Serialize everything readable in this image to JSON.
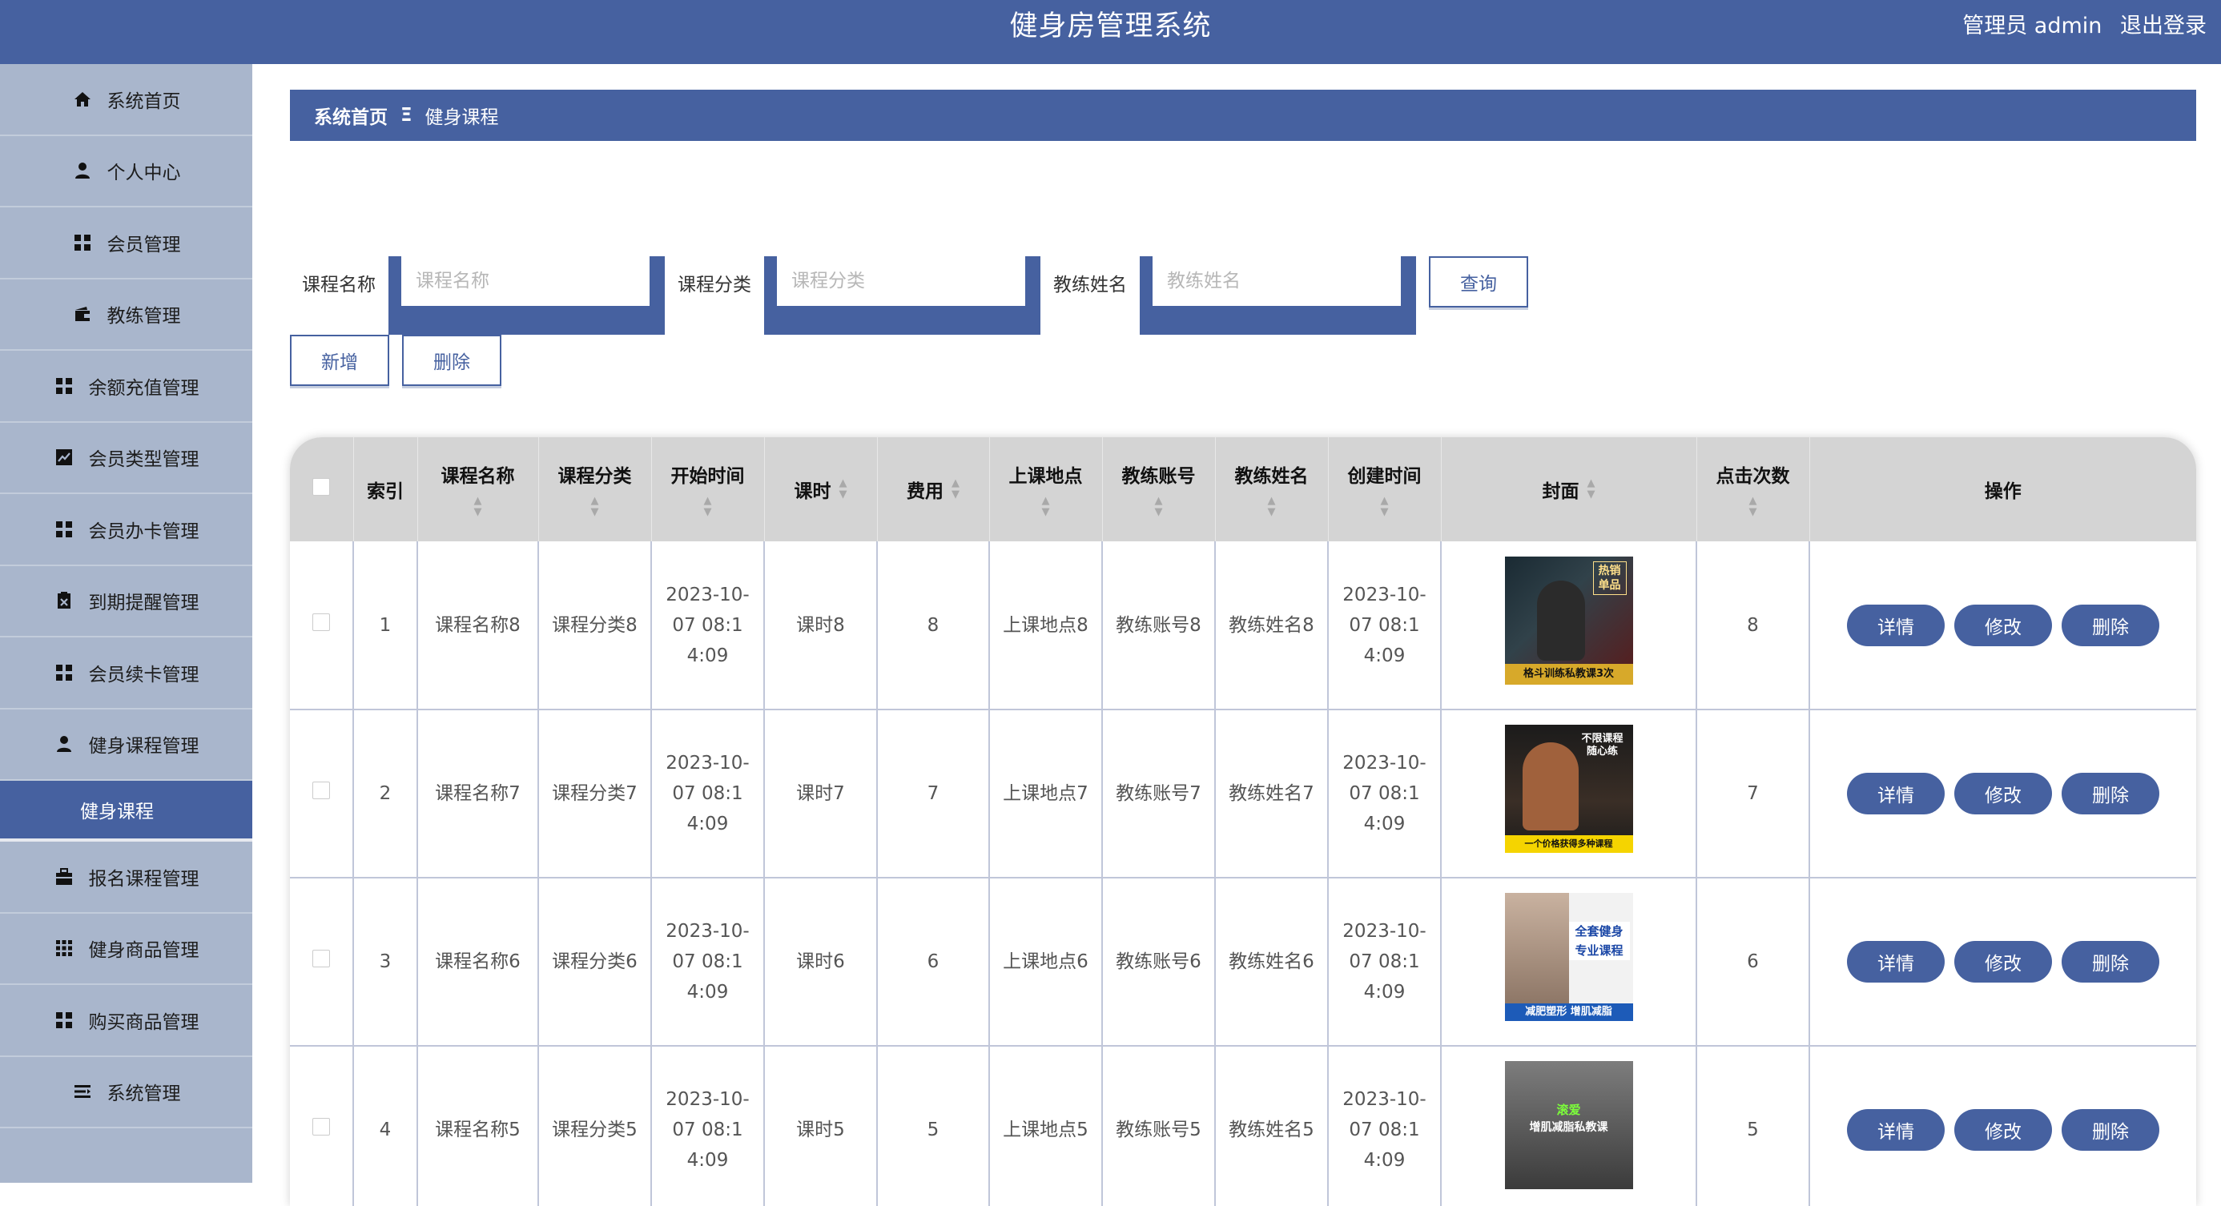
{
  "header": {
    "title": "健身房管理系统",
    "user": "管理员 admin",
    "logout": "退出登录"
  },
  "sidebar": {
    "items": [
      {
        "label": "系统首页",
        "icon": "home-icon"
      },
      {
        "label": "个人中心",
        "icon": "user-icon"
      },
      {
        "label": "会员管理",
        "icon": "grid-icon"
      },
      {
        "label": "教练管理",
        "icon": "wallet-icon"
      },
      {
        "label": "余额充值管理",
        "icon": "grid-icon"
      },
      {
        "label": "会员类型管理",
        "icon": "chart-icon"
      },
      {
        "label": "会员办卡管理",
        "icon": "grid-icon"
      },
      {
        "label": "到期提醒管理",
        "icon": "clipboard-icon"
      },
      {
        "label": "会员续卡管理",
        "icon": "grid-icon"
      },
      {
        "label": "健身课程管理",
        "icon": "user-icon"
      }
    ],
    "active_sub": "健身课程",
    "items_after": [
      {
        "label": "报名课程管理",
        "icon": "briefcase-icon"
      },
      {
        "label": "健身商品管理",
        "icon": "apps-icon"
      },
      {
        "label": "购买商品管理",
        "icon": "grid-icon"
      },
      {
        "label": "系统管理",
        "icon": "list-icon"
      }
    ]
  },
  "breadcrumb": {
    "home": "系统首页",
    "separator": "Ξ",
    "current": "健身课程"
  },
  "search": {
    "fields": [
      {
        "label": "课程名称",
        "placeholder": "课程名称"
      },
      {
        "label": "课程分类",
        "placeholder": "课程分类"
      },
      {
        "label": "教练姓名",
        "placeholder": "教练姓名"
      }
    ],
    "query_button": "查询"
  },
  "actions": {
    "add": "新增",
    "delete": "删除"
  },
  "table": {
    "columns": [
      "索引",
      "课程名称",
      "课程分类",
      "开始时间",
      "课时",
      "费用",
      "上课地点",
      "教练账号",
      "教练姓名",
      "创建时间",
      "封面",
      "点击次数",
      "操作"
    ],
    "rows": [
      {
        "index": "1",
        "name": "课程名称8",
        "category": "课程分类8",
        "start": "2023-10-07 08:14:09",
        "hours": "课时8",
        "fee": "8",
        "place": "上课地点8",
        "coach_account": "教练账号8",
        "coach_name": "教练姓名8",
        "created": "2023-10-07 08:14:09",
        "cover_text": "热销单品",
        "cover_caption": "格斗训练私教课3次",
        "clicks": "8"
      },
      {
        "index": "2",
        "name": "课程名称7",
        "category": "课程分类7",
        "start": "2023-10-07 08:14:09",
        "hours": "课时7",
        "fee": "7",
        "place": "上课地点7",
        "coach_account": "教练账号7",
        "coach_name": "教练姓名7",
        "created": "2023-10-07 08:14:09",
        "cover_text": "不限课程 随心练",
        "cover_caption": "一个价格获得多种课程",
        "clicks": "7"
      },
      {
        "index": "3",
        "name": "课程名称6",
        "category": "课程分类6",
        "start": "2023-10-07 08:14:09",
        "hours": "课时6",
        "fee": "6",
        "place": "上课地点6",
        "coach_account": "教练账号6",
        "coach_name": "教练姓名6",
        "created": "2023-10-07 08:14:09",
        "cover_text": "全套健身 专业课程",
        "cover_caption": "减肥塑形 增肌减脂",
        "clicks": "6"
      },
      {
        "index": "4",
        "name": "课程名称5",
        "category": "课程分类5",
        "start": "2023-10-07 08:14:09",
        "hours": "课时5",
        "fee": "5",
        "place": "上课地点5",
        "coach_account": "教练账号5",
        "coach_name": "教练姓名5",
        "created": "2023-10-07 08:14:09",
        "cover_text": "滚爱",
        "cover_caption": "增肌减脂私教课",
        "clicks": "5"
      }
    ],
    "row_buttons": {
      "detail": "详情",
      "edit": "修改",
      "delete": "删除"
    }
  },
  "colors": {
    "primary": "#4661a0",
    "sidebar": "#a9b6cc",
    "header_row": "#d4d4d4"
  }
}
